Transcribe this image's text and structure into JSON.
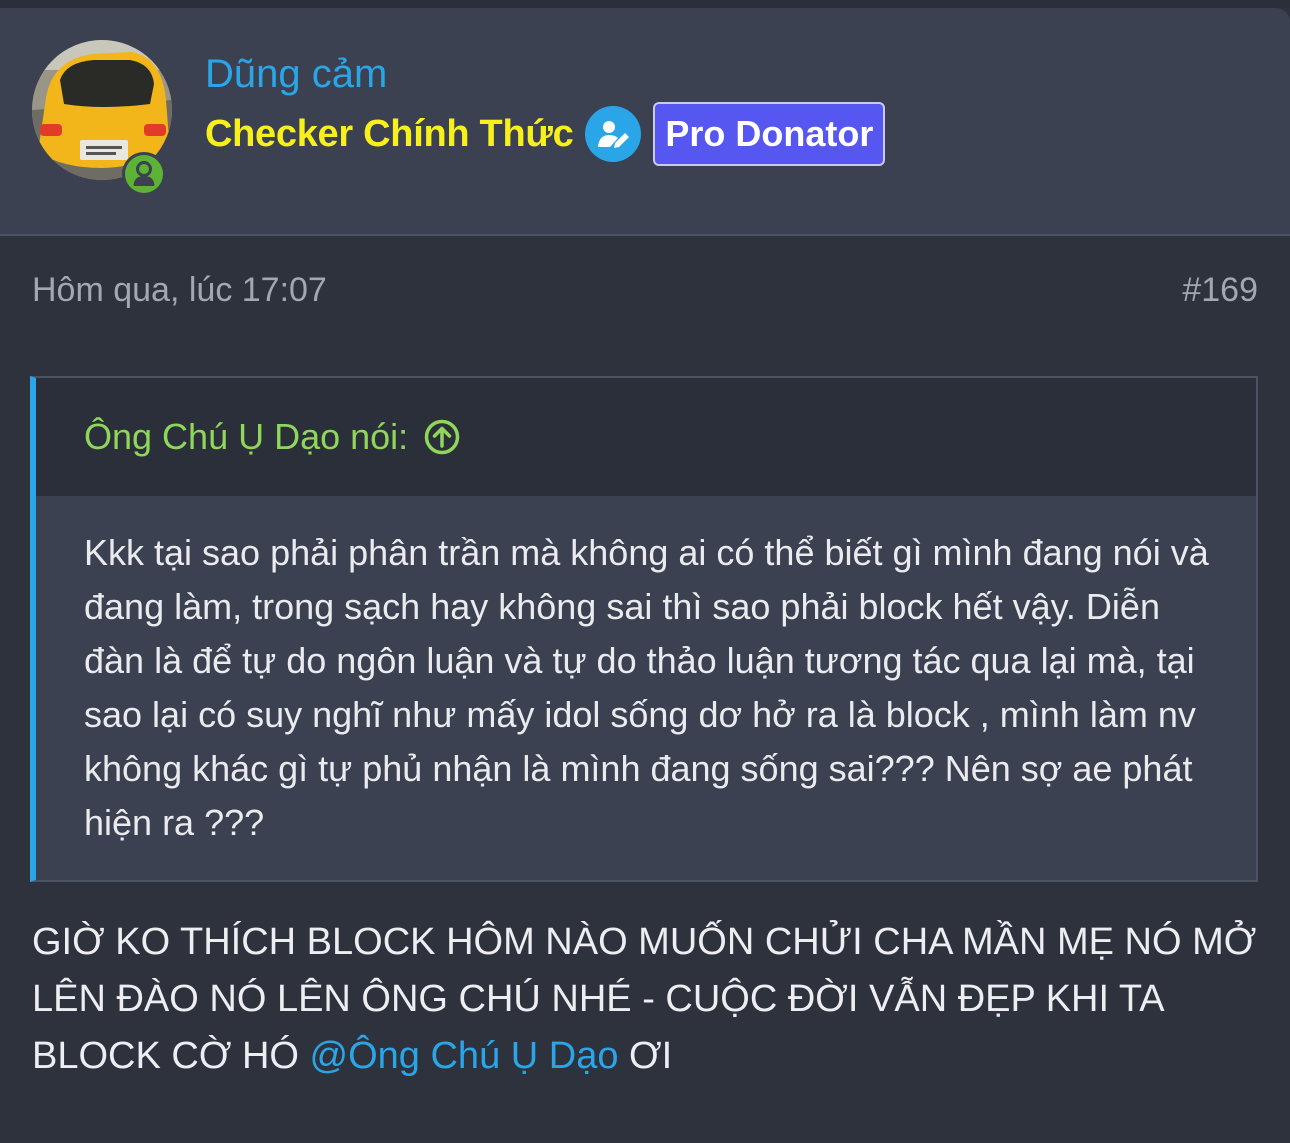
{
  "user": {
    "name": "Dũng cảm",
    "title": "Checker Chính Thức",
    "badge": "Pro Donator",
    "online_status": "online"
  },
  "post": {
    "date": "Hôm qua, lúc 17:07",
    "number": "#169"
  },
  "quote": {
    "author": "Ông Chú Ụ Dạo nói:",
    "text": "Kkk tại sao phải phân trần mà không ai có thể biết gì mình đang nói và đang làm, trong sạch hay không sai thì sao phải block hết vậy. Diễn đàn là để tự do ngôn luận và tự do thảo luận tương tác qua lại mà, tại sao lại có suy nghĩ như mấy idol sống dơ hở ra là block , mình làm nv không khác gì tự phủ nhận là mình đang sống sai??? Nên sợ ae phát hiện ra ???"
  },
  "message": {
    "text_before": "GIỜ KO THÍCH BLOCK HÔM NÀO MUỐN CHỬI CHA MẦN MẸ NÓ MỞ LÊN ĐÀO NÓ LÊN ÔNG CHÚ NHÉ - CUỘC ĐỜI VẪN ĐẸP KHI TA BLOCK CỜ HÓ ",
    "mention": "@Ông Chú Ụ Dạo",
    "text_after": " ƠI"
  },
  "colors": {
    "background": "#2e323d",
    "header": "#3b4150",
    "username": "#2aa6e8",
    "title": "#f7f01a",
    "badge": "#5656f0",
    "quote_author": "#8fd75a",
    "quote_border": "#2aa6e8",
    "online": "#5db336"
  },
  "icons": {
    "avatar": "yellow-car-avatar",
    "online": "user-online-icon",
    "checker": "user-edit-icon",
    "quote_jump": "arrow-up-circle-icon"
  }
}
